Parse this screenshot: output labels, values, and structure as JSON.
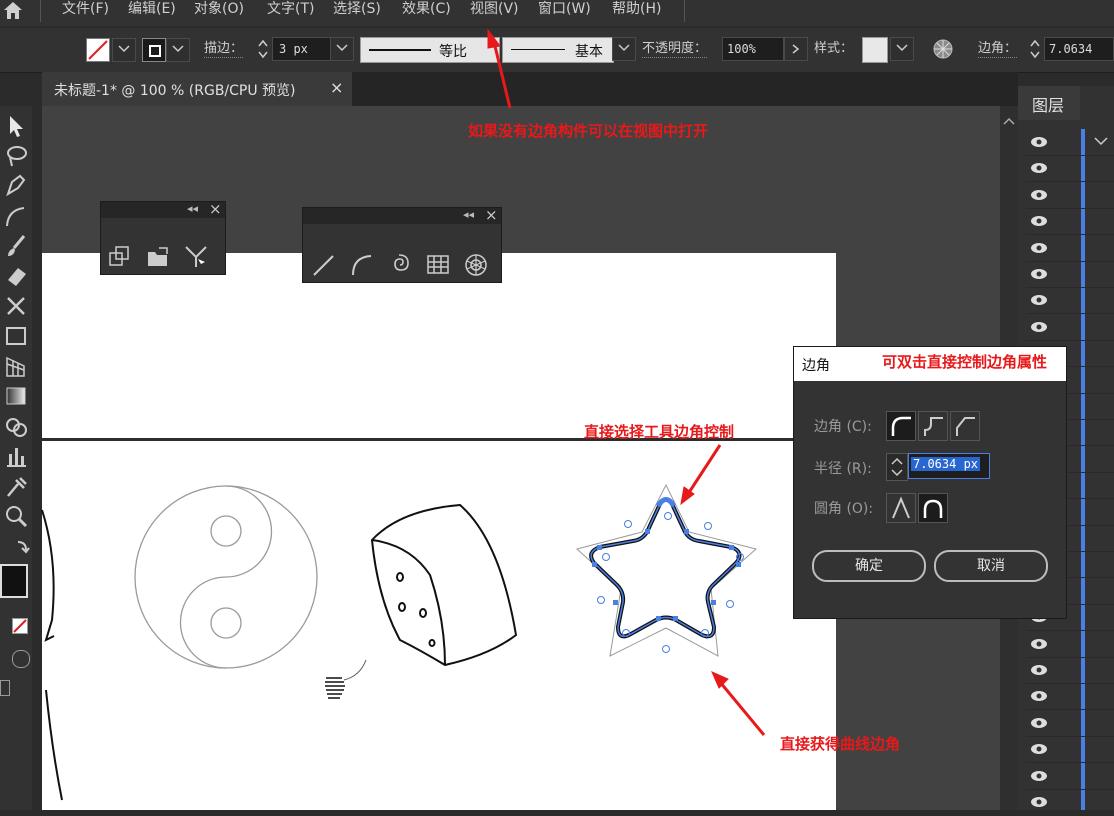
{
  "menu": {
    "items": [
      "文件(F)",
      "编辑(E)",
      "对象(O)",
      "文字(T)",
      "选择(S)",
      "效果(C)",
      "视图(V)",
      "窗口(W)",
      "帮助(H)"
    ]
  },
  "control_bar": {
    "stroke_label": "描边：",
    "stroke_value": "3 px",
    "profile_label": "等比",
    "brush_label": "基本",
    "opacity_label": "不透明度：",
    "opacity_value": "100%",
    "style_label": "样式：",
    "corner_label": "边角：",
    "corner_value": "7.0634"
  },
  "document_tab": {
    "title": "未标题-1* @ 100 % (RGB/CPU 预览)",
    "close": "×"
  },
  "layers_panel": {
    "title": "图层"
  },
  "corner_dialog": {
    "title": "边角",
    "corner_label": "边角 (C):",
    "radius_label": "半径 (R):",
    "radius_value": "7.0634 px",
    "rounding_label": "圆角 (O):",
    "ok": "确定",
    "cancel": "取消"
  },
  "annotations": {
    "view_menu_hint": "如果没有边角构件可以在视图中打开",
    "double_click_hint": "可双击直接控制边角属性",
    "direct_select_hint": "直接选择工具边角控制",
    "curve_corner_hint": "直接获得曲线边角"
  },
  "colors": {
    "annotation": "#e8191a",
    "accent": "#4a7fe6",
    "panel": "#323232"
  }
}
